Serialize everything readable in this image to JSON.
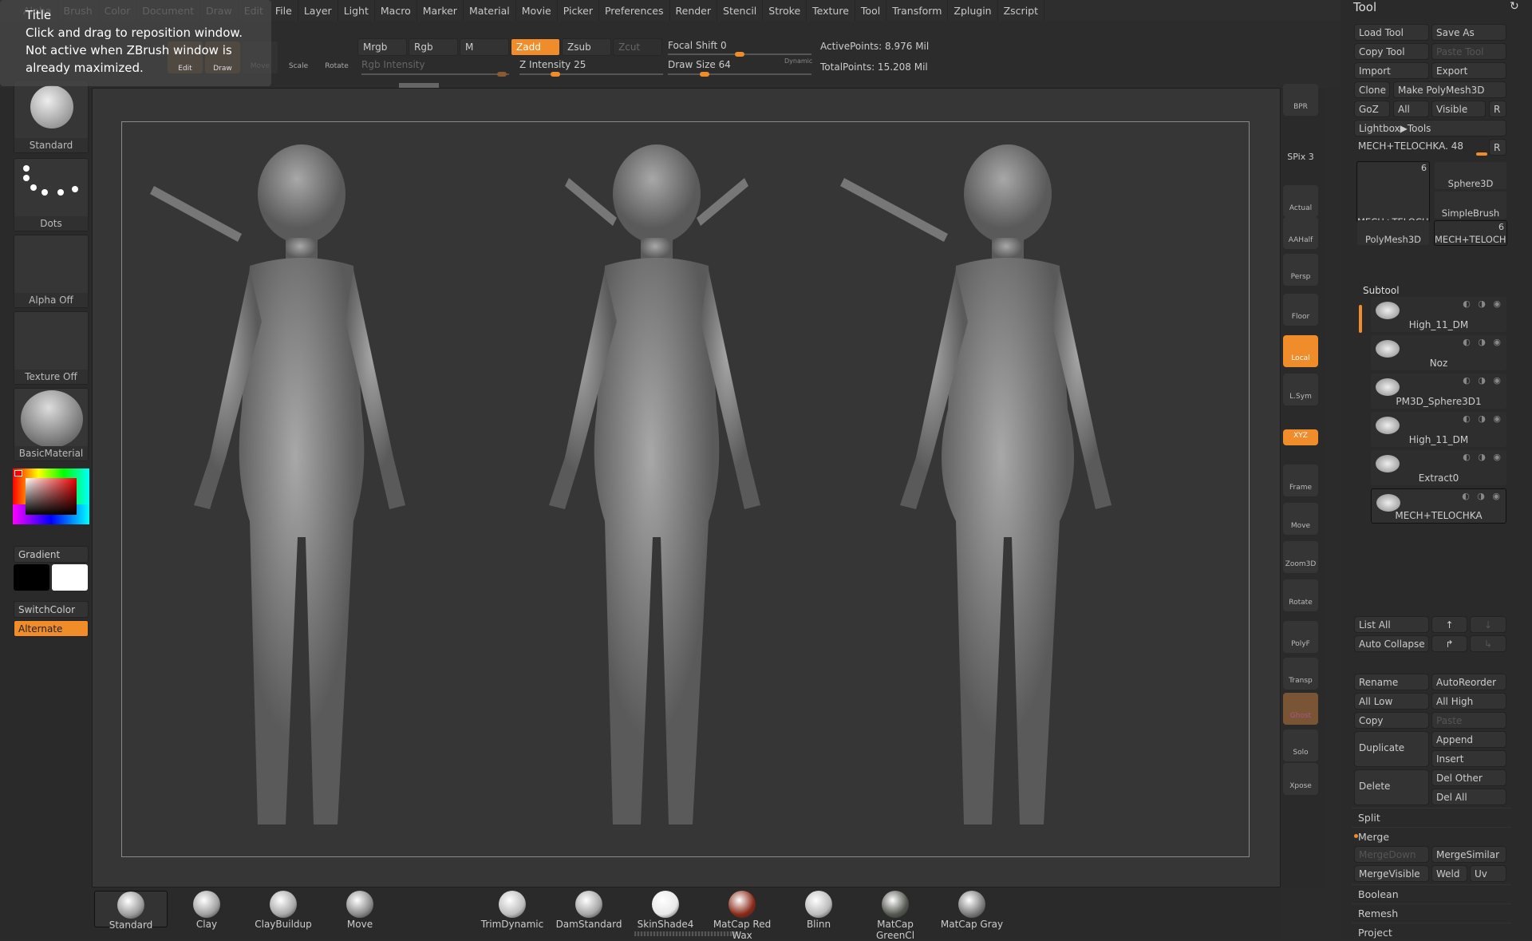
{
  "menu": [
    "Alpha",
    "Brush",
    "Color",
    "Document",
    "Draw",
    "Edit",
    "File",
    "Layer",
    "Light",
    "Macro",
    "Marker",
    "Material",
    "Movie",
    "Picker",
    "Preferences",
    "Render",
    "Stencil",
    "Stroke",
    "Texture",
    "Tool",
    "Transform",
    "Zplugin",
    "Zscript"
  ],
  "tooltip": {
    "title": "Title",
    "line1": "Click and drag to reposition window.",
    "line2": "Not active when ZBrush window is already maximized."
  },
  "toolbar": {
    "edit": "Edit",
    "draw": "Draw",
    "move": "Move",
    "scale": "Scale",
    "rotate": "Rotate",
    "mrgb": "Mrgb",
    "rgb": "Rgb",
    "m": "M",
    "zadd": "Zadd",
    "zsub": "Zsub",
    "zcut": "Zcut",
    "rgb_intensity": "Rgb Intensity",
    "z_intensity": "Z Intensity 25",
    "focal_shift": "Focal Shift 0",
    "draw_size": "Draw Size 64",
    "dynamic": "Dynamic",
    "active_points": "ActivePoints: 8.976 Mil",
    "total_points": "TotalPoints: 15.208 Mil",
    "z_intensity_value": 25,
    "focal_shift_value": 0,
    "draw_size_value": 64
  },
  "left": {
    "brush": "Standard",
    "stroke": "Dots",
    "alpha": "Alpha Off",
    "texture": "Texture Off",
    "material": "BasicMaterial",
    "gradient": "Gradient",
    "switch_color": "SwitchColor",
    "alternate": "Alternate",
    "main_color": "#000000",
    "secondary_color": "#ffffff"
  },
  "vbar": [
    "BPR",
    "SPix 3",
    "Actual",
    "AAHalf",
    "Persp",
    "Floor",
    "Local",
    "L.Sym",
    "XYZ",
    "Frame",
    "Move",
    "Zoom3D",
    "Rotate",
    "PolyF",
    "Transp",
    "Ghost",
    "Solo",
    "Xpose"
  ],
  "tool": {
    "title": "Tool",
    "load": "Load Tool",
    "save_as": "Save As",
    "copy": "Copy Tool",
    "paste": "Paste Tool",
    "import": "Import",
    "export": "Export",
    "clone": "Clone",
    "make_polymesh": "Make PolyMesh3D",
    "goz": "GoZ",
    "all": "All",
    "visible": "Visible",
    "r": "R",
    "lightbox": "Lightbox▶Tools",
    "current": "MECH+TELOCHKA. 48",
    "thumbs": [
      {
        "name": "MECH+TELOCHKA",
        "count": "6"
      },
      {
        "name": "Sphere3D"
      },
      {
        "name": "SimpleBrush"
      },
      {
        "name": "PolyMesh3D"
      },
      {
        "name": "MECH+TELOCHKA",
        "count": "6"
      }
    ],
    "subtool_title": "Subtool",
    "subtools": [
      "High_11_DM",
      "Noz",
      "PM3D_Sphere3D1",
      "High_11_DM",
      "Extract0",
      "MECH+TELOCHKA"
    ],
    "list_all": "List All",
    "auto_collapse": "Auto Collapse",
    "rename": "Rename",
    "autoreorder": "AutoReorder",
    "all_low": "All Low",
    "all_high": "All High",
    "copy_st": "Copy",
    "paste_st": "Paste",
    "duplicate": "Duplicate",
    "append": "Append",
    "insert": "Insert",
    "delete": "Delete",
    "del_other": "Del Other",
    "del_all": "Del All",
    "split": "Split",
    "merge": "Merge",
    "merge_down": "MergeDown",
    "merge_similar": "MergeSimilar",
    "merge_visible": "MergeVisible",
    "weld": "Weld",
    "uv": "Uv",
    "boolean": "Boolean",
    "remesh": "Remesh",
    "project": "Project"
  },
  "shelf": [
    {
      "label": "Standard",
      "color": "#9a9a9a"
    },
    {
      "label": "Clay",
      "color": "#a0a0a0"
    },
    {
      "label": "ClayBuildup",
      "color": "#a8a8a8"
    },
    {
      "label": "Move",
      "color": "#8a8a8a"
    },
    {
      "label": "TrimDynamic",
      "color": "#bdbdbd"
    },
    {
      "label": "DamStandard",
      "color": "#a5a5a5"
    },
    {
      "label": "SkinShade4",
      "color": "#e8e8e8"
    },
    {
      "label": "MatCap Red Wax",
      "color": "#8a2a18"
    },
    {
      "label": "Blinn",
      "color": "#bbbbbb"
    },
    {
      "label": "MatCap GreenCl",
      "color": "#555850"
    },
    {
      "label": "MatCap Gray",
      "color": "#7a7a7a"
    }
  ],
  "accent": "#f08c2a"
}
